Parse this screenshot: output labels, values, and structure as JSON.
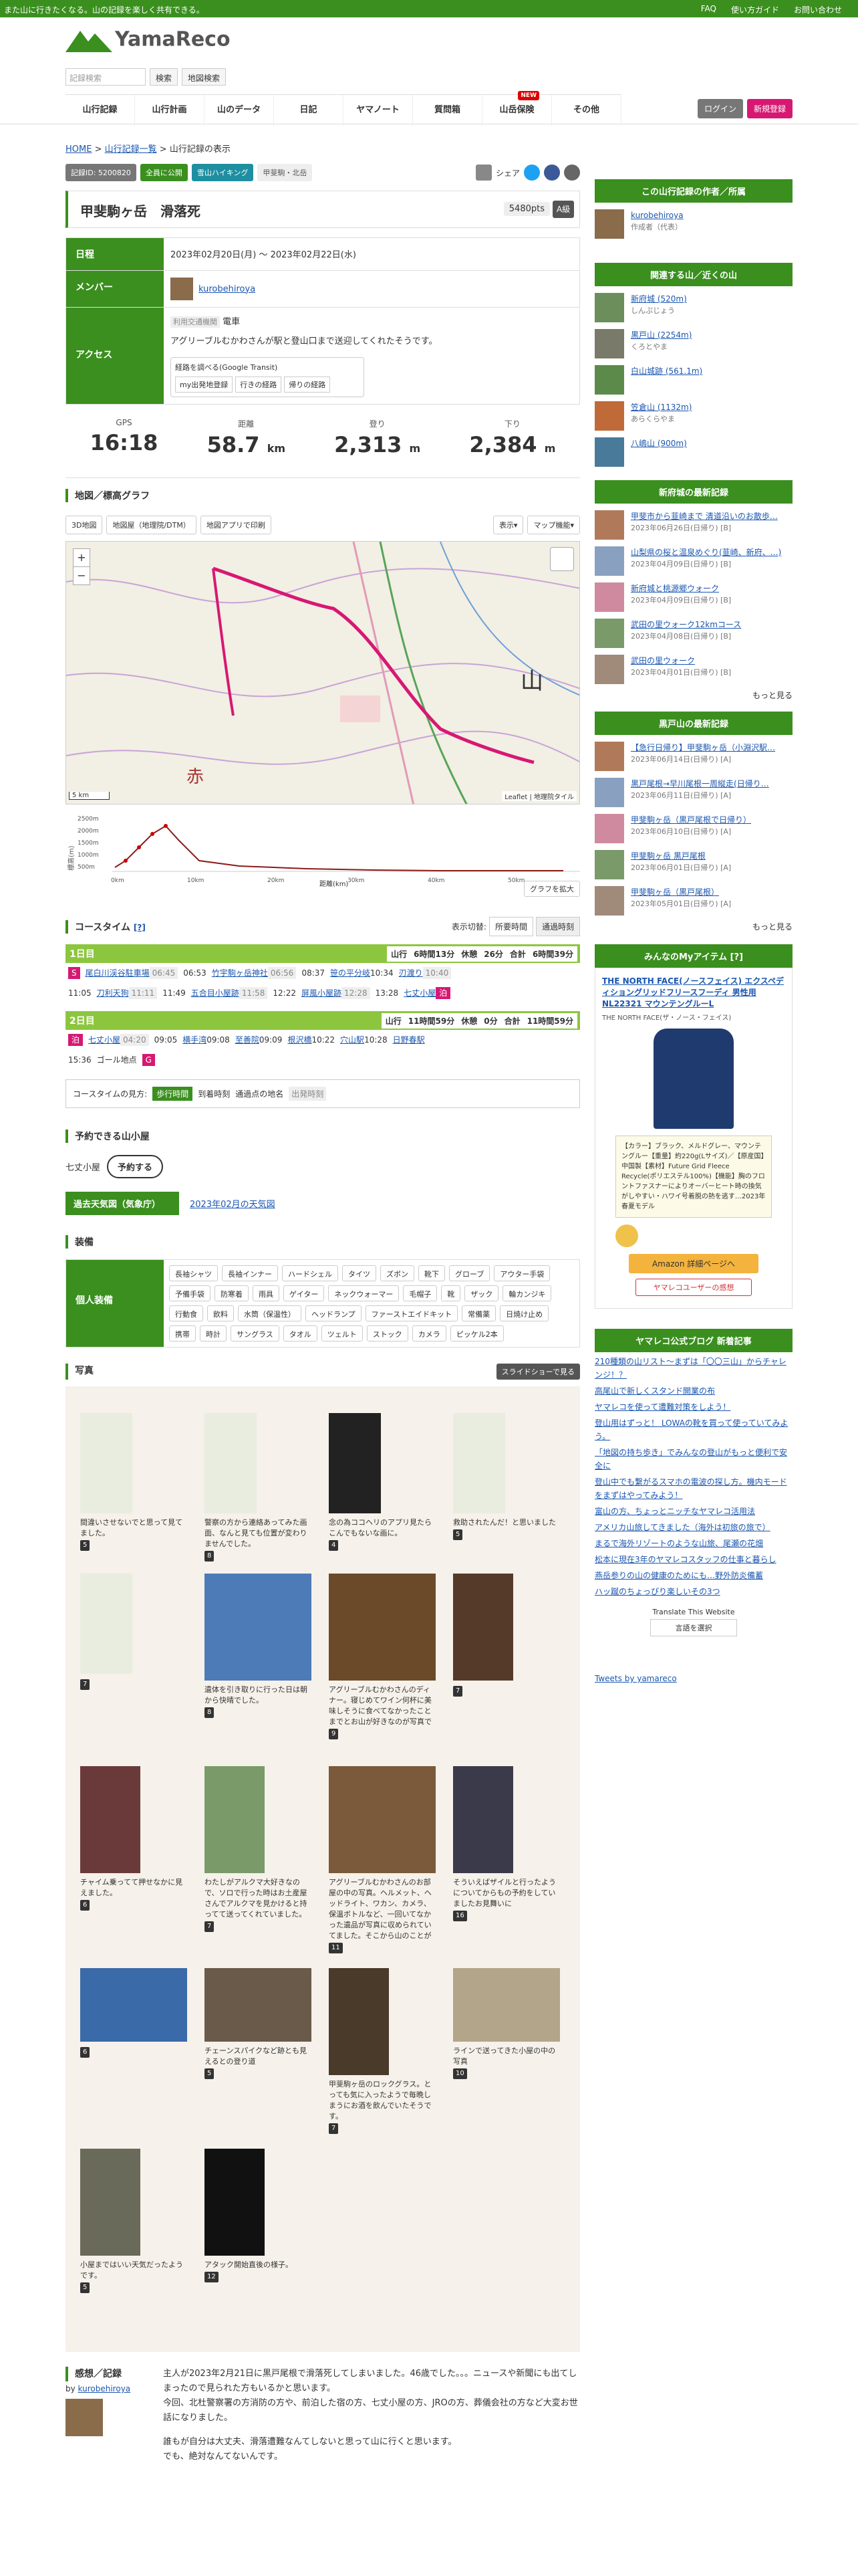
{
  "topbar": {
    "tagline": "また山に行きたくなる。山の記録を楽しく共有できる。",
    "faq": "FAQ",
    "guide": "使い方ガイド",
    "contact": "お問い合わせ"
  },
  "header": {
    "logo": "YamaReco",
    "search_placeholder": "記録検索",
    "search_btn": "検索",
    "map_search_btn": "地図検索",
    "login": "ログイン",
    "register": "新規登録"
  },
  "nav": [
    "山行記録",
    "山行計画",
    "山のデータ",
    "日記",
    "ヤマノート",
    "質問箱",
    "山岳保険",
    "その他"
  ],
  "nav_new": "NEW",
  "breadcrumb": [
    "HOME",
    "山行記録一覧",
    "山行記録の表示"
  ],
  "pills": {
    "record_no": "記録ID: 5200820",
    "visibility": "全員に公開",
    "type": "雪山ハイキング",
    "area": "甲斐駒・北岳",
    "share": "シェア"
  },
  "title": "甲斐駒ヶ岳　滑落死",
  "points": "5480pts",
  "grade": "A級",
  "info": {
    "date_label": "日程",
    "date": "2023年02月20日(月) 〜 2023年02月22日(水)",
    "member_label": "メンバー",
    "member": "kurobehiroya",
    "access_label": "アクセス",
    "transport_tag": "利用交通機関",
    "transport": "電車",
    "access_text": "アグリーブルむかわさんが駅と登山口まで送迎してくれたそうです。",
    "transit_title": "経路を調べる(Google Transit)",
    "transit_btns": [
      "my出発地登録",
      "行きの経路",
      "帰りの経路"
    ]
  },
  "stats": [
    {
      "label": "GPS",
      "value": "16:18",
      "unit": ""
    },
    {
      "label": "距離",
      "value": "58.7",
      "unit": "km"
    },
    {
      "label": "登り",
      "value": "2,313",
      "unit": "m"
    },
    {
      "label": "下り",
      "value": "2,384",
      "unit": "m"
    }
  ],
  "map_section": "地図／標高グラフ",
  "map_tabs": [
    "3D地図",
    "地図屋（地理院/DTM）",
    "地図アプリで印刷"
  ],
  "map_right": [
    "表示▾",
    "マップ機能▾"
  ],
  "map_scale": "5 km",
  "map_attrib": "Leaflet | 地理院タイル",
  "graph": {
    "ylabel": "標高(m)",
    "yticks": [
      "2500m",
      "2000m",
      "1500m",
      "1000m",
      "500m"
    ],
    "xticks": [
      "0km",
      "10km",
      "20km",
      "30km",
      "40km",
      "50km"
    ],
    "xlabel": "距離(km)",
    "expand": "グラフを拡大"
  },
  "coursetime": {
    "title": "コースタイム",
    "help": "[?]",
    "switch_label": "表示切替:",
    "tabs": [
      "所要時間",
      "通過時刻"
    ],
    "day1": {
      "label": "1日目",
      "stats": [
        "山行",
        "6時間13分",
        "休憩",
        "26分",
        "合計",
        "6時間39分"
      ],
      "seq": [
        "尾白川渓谷駐車場",
        "06:45",
        "06:53",
        "竹宇駒ヶ岳神社",
        "06:56",
        "08:37",
        "笹の平分岐",
        "10:34",
        "刃渡り",
        "10:40",
        "11:05",
        "刀利天狗",
        "11:11",
        "11:49",
        "五合目小屋跡",
        "11:58",
        "12:22",
        "屏風小屋跡",
        "12:28",
        "13:28",
        "七丈小屋",
        "泊"
      ]
    },
    "day2": {
      "label": "2日目",
      "stats": [
        "山行",
        "11時間59分",
        "休憩",
        "0分",
        "合計",
        "11時間59分"
      ],
      "seq": [
        "泊",
        "七丈小屋",
        "04:20",
        "09:05",
        "横手湾",
        "09:08",
        "至善院",
        "09:09",
        "根沢橋",
        "10:22",
        "穴山駅",
        "10:28",
        "日野春駅",
        "15:36",
        "ゴール地点",
        "G"
      ]
    },
    "legend": [
      "コースタイムの見方:",
      "歩行時間",
      "到着時刻",
      "通過点の地名",
      "出発時刻"
    ]
  },
  "huts": {
    "title": "予約できる山小屋",
    "hut": "七丈小屋",
    "btn": "予約する"
  },
  "weather": {
    "label": "過去天気図（気象庁）",
    "link": "2023年02月の天気図"
  },
  "gear": {
    "title": "装備",
    "label": "個人装備",
    "items": [
      "長袖シャツ",
      "長袖インナー",
      "ハードシェル",
      "タイツ",
      "ズボン",
      "靴下",
      "グローブ",
      "アウター手袋",
      "予備手袋",
      "防寒着",
      "雨具",
      "ゲイター",
      "ネックウォーマー",
      "毛帽子",
      "靴",
      "ザック",
      "輪カンジキ",
      "行動食",
      "飲料",
      "水筒（保温性）",
      "ヘッドランプ",
      "ファーストエイドキット",
      "常備薬",
      "日焼け止め",
      "携帯",
      "時計",
      "サングラス",
      "タオル",
      "ツェルト",
      "ストック",
      "カメラ",
      "ピッケル2本"
    ]
  },
  "photos": {
    "title": "写真",
    "slideshow": "スライドショーで見る",
    "items": [
      {
        "cap": "間違いさせないでと思って見てました。",
        "like": "5"
      },
      {
        "cap": "警察の方から連絡あってみた画面、なんと見ても位置が変わりませんでした。",
        "like": "8"
      },
      {
        "cap": "念の為ココヘリのアプリ見たらこんでもないな画に。",
        "like": "4"
      },
      {
        "cap": "救助されたんだ！と思いました",
        "like": "5"
      },
      {
        "cap": "",
        "like": "7"
      },
      {
        "cap": "遺体を引き取りに行った日は朝から快晴でした。",
        "like": "8"
      },
      {
        "cap": "アグリーブルむかわさんのディナー。寝じめてワイン何杯に美味しそうに食べてなかったことまでとお山が好きなのが写真で",
        "like": "9"
      },
      {
        "cap": "",
        "like": "7"
      },
      {
        "cap": "チャイム乗ってて押せなかに見えました。",
        "like": "6"
      },
      {
        "cap": "わたしがアルクマ大好きなので、ソロで行った時はお土産屋さんでアルクマを見かけると持ってて送ってくれていました。",
        "like": "7"
      },
      {
        "cap": "アグリーブルむかわさんのお部屋の中の写真。ヘルメット、ヘッドライト、ワカン、カメラ、保温ボトルなど、一回いてなかった遺品が写真に収められていてました。そこから山のことが",
        "like": "11"
      },
      {
        "cap": "そういえばザイルと行ったようについてからもの予約をしていましたお見舞いに",
        "like": "16"
      },
      {
        "cap": "",
        "like": "6"
      },
      {
        "cap": "チェーンスパイクなど跡とも見えるとの登り道",
        "like": "5"
      },
      {
        "cap": "甲斐駒ヶ岳のロックグラス。とっても気に入ったようで毎晩しまうにお酒を飲んでいたそうです。",
        "like": "7"
      },
      {
        "cap": "ラインで送ってきた小屋の中の写真",
        "like": "10"
      },
      {
        "cap": "小屋まではいい天気だったようです。",
        "like": "5"
      },
      {
        "cap": "アタック開始直後の様子。",
        "like": "12"
      }
    ]
  },
  "diary": {
    "title": "感想／記録",
    "by": "by",
    "author": "kurobehiroya",
    "lines": [
      "主人が2023年2月21日に黒戸尾根で滑落死してしまいました。46歳でした。。。ニュースや新聞にも出てしまったので見られた方もいるかと思います。",
      "今回、北杜警察署の方消防の方や、前泊した宿の方、七丈小屋の方、JROの方、葬儀会社の方など大変お世話になりました。",
      "",
      "誰もが自分は大丈夫、滑落遭難なんてしないと思って山に行くと思います。",
      "でも、絶対なんてないんです。"
    ]
  },
  "sidebar": {
    "owner_title": "この山行記録の作者／所属",
    "owner_name": "kurobehiroya",
    "owner_sub": "作成者（代表）",
    "mtn_title": "関連する山／近くの山",
    "mountains": [
      {
        "name": "新府城 (520m)",
        "sub": "しんぷじょう"
      },
      {
        "name": "黒戸山 (2254m)",
        "sub": "くろとやま"
      },
      {
        "name": "白山城跡 (561.1m)",
        "sub": ""
      },
      {
        "name": "笠倉山 (1132m)",
        "sub": "あらくらやま"
      },
      {
        "name": "八嶋山 (900m)",
        "sub": ""
      }
    ],
    "recent1_title": "新府城の最新記録",
    "recent1": [
      {
        "t": "甲斐市から韮崎まで 清道沿いのお散歩…",
        "d": "2023年06月26日(日帰り) [B]"
      },
      {
        "t": "山梨県の桜と温泉めぐり(韮崎、新府、…)",
        "d": "2023年04月09日(日帰り) [B]"
      },
      {
        "t": "新府城と桃源郷ウォーク",
        "d": "2023年04月09日(日帰り) [B]"
      },
      {
        "t": "武田の里ウォーク12kmコース",
        "d": "2023年04月08日(日帰り) [B]"
      },
      {
        "t": "武田の里ウォーク",
        "d": "2023年04月01日(日帰り) [B]"
      }
    ],
    "more": "もっと見る",
    "recent2_title": "黒戸山の最新記録",
    "recent2": [
      {
        "t": "【急行日帰り】甲斐駒ヶ岳（小淵沢駅…",
        "d": "2023年06月14日(日帰り) [A]"
      },
      {
        "t": "黒戸尾根→早川尾根一周縦走(日帰り…",
        "d": "2023年06月11日(日帰り) [A]"
      },
      {
        "t": "甲斐駒ヶ岳（黒戸尾根で日帰り）",
        "d": "2023年06月10日(日帰り) [A]"
      },
      {
        "t": "甲斐駒ヶ岳 黒戸尾根",
        "d": "2023年06月01日(日帰り) [A]"
      },
      {
        "t": "甲斐駒ヶ岳（黒戸尾根）",
        "d": "2023年05月01日(日帰り) [A]"
      }
    ],
    "myitem_title": "みんなのMyアイテム",
    "myitem_help": "[?]",
    "item_name": "THE NORTH FACE(ノースフェイス) エクスペディショングリッドフリースフーディ 男性用 NL22321 マウンテングルーL",
    "item_brand": "THE NORTH FACE(ザ・ノース・フェイス)",
    "item_desc": "【カラー】ブラック、メルドグレー、マウンテングルー【重量】約220g(Lサイズ)／【原産国】中国製【素材】Future Grid Fleece Recycle(ポリエステル100%)【機能】胸のフロントファスナーによりオーバーヒート時の換気がしやすい・ハワイ号着脱の熱を逃す…2023年春夏モデル",
    "amazon": "Amazon 詳細ページへ",
    "review": "ヤマレコユーザーの感想",
    "blog_title": "ヤマレコ公式ブログ 新着記事",
    "blog": [
      "210種類の山リスト〜まずは「〇〇三山」からチャレンジ！？",
      "高尾山で新しくスタンド開業の布",
      "ヤマレコを使って遭難対策をしよう！",
      "登山用はずっと！ LOWAの靴を買って使っていてみよう。",
      "「地図の持ち歩き」でみんなの登山がもっと便利で安全に",
      "登山中でも繋がるスマホの電波の探し方。機内モードをまずはやってみよう！",
      "富山の方、ちょっとニッチなヤマレコ活用法",
      "アメリカ山旅してきました（海外は初旅の旅で）",
      "まるで海外リゾートのような山旅、尾瀬の花畑",
      "松本に現在3年のヤマレコスタッフの仕事と暮らし",
      "燕岳参りの山の健康のためにも…野外防炎備蓄",
      "ハッ蹴のちょっぴり楽しいその3つ"
    ],
    "translate": "Translate This Website",
    "lang_select": "言語を選択",
    "tweets": "Tweets by yamareco"
  },
  "colors": {
    "green": "#3a8f1e",
    "light_green": "#8cc63f",
    "pink": "#d71873"
  }
}
